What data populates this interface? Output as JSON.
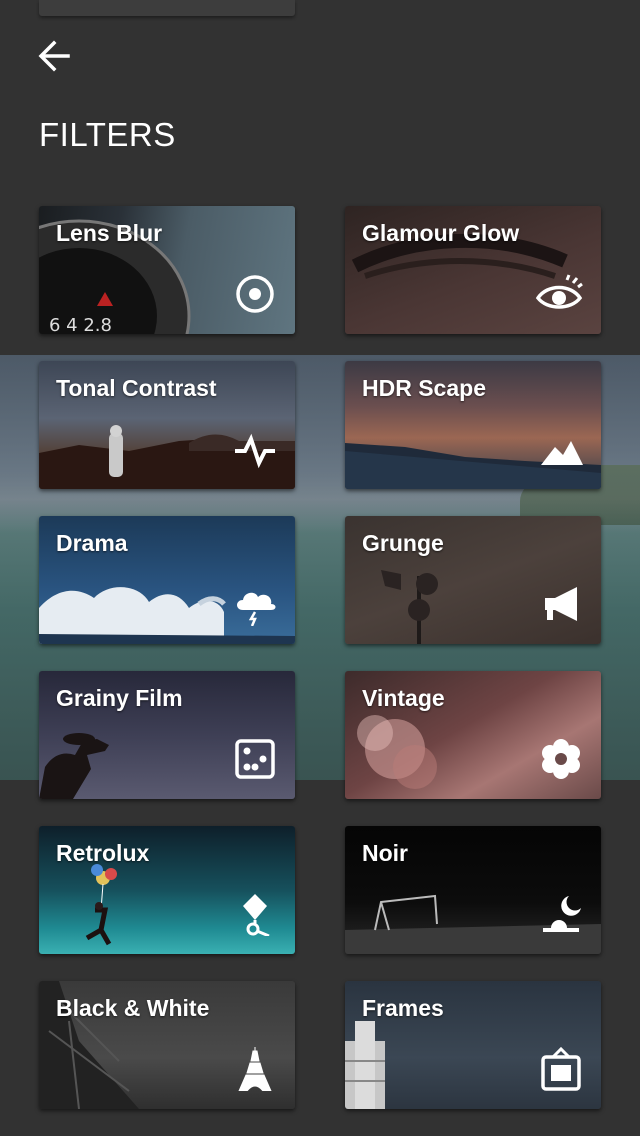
{
  "header": {
    "title": "FILTERS",
    "back_icon": "arrow-left-icon"
  },
  "filters": [
    {
      "label": "Lens Blur",
      "icon": "target-icon"
    },
    {
      "label": "Glamour Glow",
      "icon": "eye-icon"
    },
    {
      "label": "Tonal Contrast",
      "icon": "pulse-icon"
    },
    {
      "label": "HDR Scape",
      "icon": "mountains-icon"
    },
    {
      "label": "Drama",
      "icon": "storm-cloud-icon"
    },
    {
      "label": "Grunge",
      "icon": "megaphone-icon"
    },
    {
      "label": "Grainy Film",
      "icon": "dice-icon"
    },
    {
      "label": "Vintage",
      "icon": "flower-icon"
    },
    {
      "label": "Retrolux",
      "icon": "kite-icon"
    },
    {
      "label": "Noir",
      "icon": "moon-icon"
    },
    {
      "label": "Black & White",
      "icon": "eiffel-tower-icon"
    },
    {
      "label": "Frames",
      "icon": "frame-icon"
    }
  ],
  "colors": {
    "background": "#323232",
    "text": "#ffffff"
  }
}
